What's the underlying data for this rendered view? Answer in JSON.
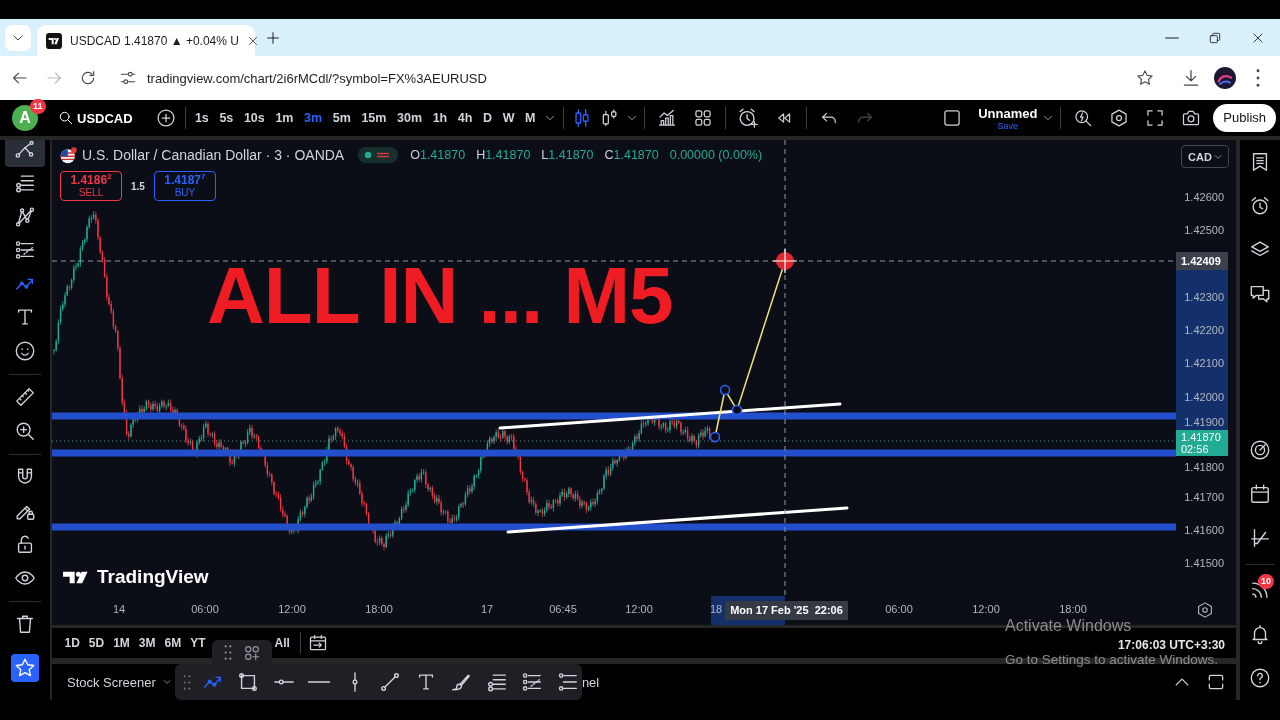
{
  "browser": {
    "tabs": [
      {
        "title": "USDCAD 1.41870 ▲ +0.04% U",
        "selected": true
      }
    ],
    "nav": [
      {
        "kind": "back",
        "disabled": false
      },
      {
        "kind": "forward",
        "disabled": true
      },
      {
        "kind": "reload",
        "disabled": false
      }
    ],
    "address": "tradingview.com/chart/2i6rMCdl/?symbol=FX%3AEURUSD"
  },
  "toolbar": {
    "account": {
      "initial": "A",
      "badge": "11"
    },
    "symbol": "USDCAD",
    "intervals": [
      {
        "label": "1s",
        "selected": false
      },
      {
        "label": "5s",
        "selected": false
      },
      {
        "label": "10s",
        "selected": false
      },
      {
        "label": "1m",
        "selected": false
      },
      {
        "label": "3m",
        "selected": true
      },
      {
        "label": "5m",
        "selected": false
      },
      {
        "label": "15m",
        "selected": false
      },
      {
        "label": "30m",
        "selected": false
      },
      {
        "label": "1h",
        "selected": false
      },
      {
        "label": "4h",
        "selected": false
      },
      {
        "label": "D",
        "selected": false
      },
      {
        "label": "W",
        "selected": false
      },
      {
        "label": "M",
        "selected": false
      }
    ],
    "history": [
      {
        "kind": "undo",
        "disabled": false
      },
      {
        "kind": "redo",
        "disabled": true
      }
    ],
    "layout": {
      "name": "Unnamed",
      "action": "Save"
    },
    "publish": "Publish"
  },
  "drawing_tools": [
    [
      {
        "kind": "chevron",
        "selected": false,
        "hovered": true
      },
      {
        "kind": "lines",
        "selected": false,
        "hovered": false
      },
      {
        "kind": "pattern",
        "selected": false,
        "hovered": false
      },
      {
        "kind": "forecast",
        "selected": false,
        "hovered": false
      },
      {
        "kind": "trend",
        "selected": true,
        "hovered": false
      },
      {
        "kind": "text",
        "selected": false,
        "hovered": false
      },
      {
        "kind": "smiley",
        "selected": false,
        "hovered": false
      }
    ],
    [
      {
        "kind": "ruler",
        "selected": false,
        "hovered": false
      },
      {
        "kind": "zoom",
        "selected": false,
        "hovered": false
      }
    ],
    [
      {
        "kind": "magnet",
        "selected": false,
        "hovered": false
      },
      {
        "kind": "pencil_lock",
        "selected": false,
        "hovered": false
      },
      {
        "kind": "lock",
        "selected": false,
        "hovered": false
      },
      {
        "kind": "eye",
        "selected": false,
        "hovered": false
      }
    ],
    [
      {
        "kind": "trash",
        "selected": false,
        "hovered": false
      },
      {
        "kind": "star",
        "selected": true,
        "hovered": false
      }
    ]
  ],
  "legend": {
    "title": "U.S. Dollar / Canadian Dollar · 3 · OANDA",
    "ohlc": [
      {
        "key": "O",
        "value": "1.41870"
      },
      {
        "key": "H",
        "value": "1.41870"
      },
      {
        "key": "L",
        "value": "1.41870"
      },
      {
        "key": "C",
        "value": "1.41870"
      }
    ],
    "change": "0.00000 (0.00%)"
  },
  "trade": {
    "sell": {
      "price": "1.4186$^{2}$",
      "label": "SELL"
    },
    "spread": "1.5",
    "buy": {
      "price": "1.4187$^{7}$",
      "label": "BUY"
    }
  },
  "chart": {
    "currency": "CAD",
    "note": "ALL IN ... M5",
    "logo": "TradingView",
    "price_ticks": [
      "1.42600",
      "1.42500",
      "1.42300",
      "1.42200",
      "1.42100",
      "1.42000",
      "1.41900",
      "1.41800",
      "1.41700",
      "1.41600",
      "1.41500"
    ],
    "crosshair_price": "1.42409",
    "last_price": "1.41870",
    "countdown": "02:56",
    "time_ticks": [
      "14",
      "06:00",
      "12:00",
      "18:00",
      "17",
      "06:45",
      "12:00",
      "18",
      "06:00",
      "12:00",
      "18:00"
    ],
    "crosshair_time": "Mon 17 Feb '25  22:06"
  },
  "ranges": [
    [
      "1D",
      "5D",
      "1M",
      "3M",
      "6M",
      "YT"
    ],
    [
      "All"
    ]
  ],
  "clock": "17:06:03 UTC+3:30",
  "panel": {
    "screener": "Stock Screener",
    "tab": "nel"
  },
  "floating_tools": [
    {
      "kind": "trend",
      "selected": true
    },
    {
      "kind": "rectangle",
      "selected": false
    },
    {
      "kind": "ray",
      "selected": false
    },
    {
      "kind": "hline",
      "selected": false
    },
    {
      "kind": "vline",
      "selected": false
    },
    {
      "kind": "line",
      "selected": false
    },
    {
      "kind": "text",
      "selected": false
    },
    {
      "kind": "brush",
      "selected": false
    },
    {
      "kind": "lines",
      "selected": false
    },
    {
      "kind": "forecast",
      "selected": false
    },
    {
      "kind": "channel",
      "selected": false
    }
  ],
  "sidebar": {
    "badge": "10"
  },
  "os_notice": {
    "title": "Activate Windows",
    "hint": "Go to Settings to activate Windows."
  }
}
